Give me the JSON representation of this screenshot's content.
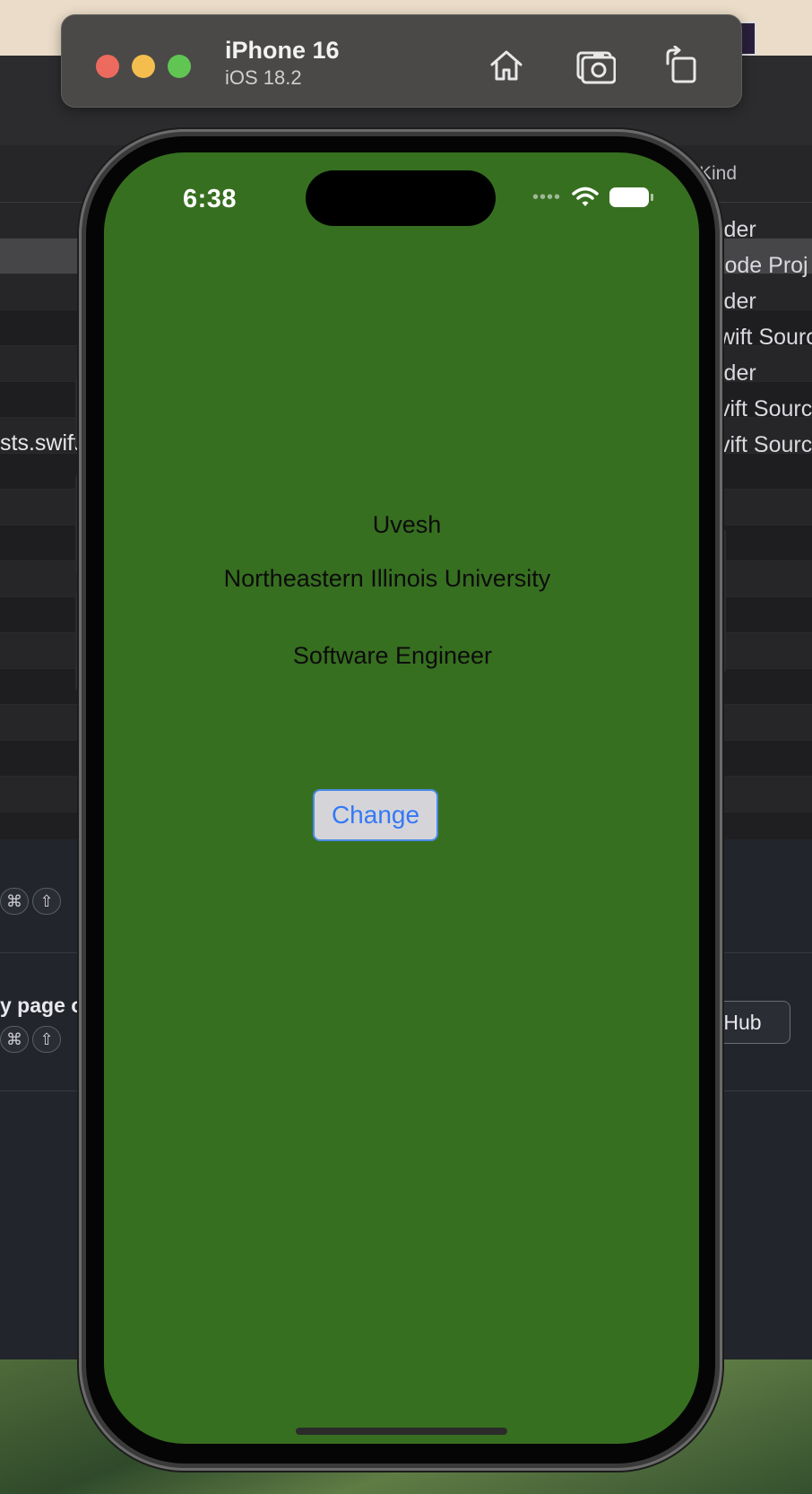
{
  "simulator": {
    "device_name": "iPhone 16",
    "os_version": "iOS 18.2",
    "toolbar_icons": [
      "home-icon",
      "screenshot-icon",
      "rotate-icon"
    ]
  },
  "status_bar": {
    "time": "6:38",
    "signal": "••••"
  },
  "app": {
    "name": "Uvesh",
    "university": "Northeastern Illinois University",
    "role": "Software Engineer",
    "button_label": "Change",
    "background_color": "#376f20",
    "button_text_color": "#3478f6"
  },
  "background_window": {
    "column_header": "Kind",
    "left_text": "sts.swift",
    "kinds": [
      "Folder",
      "Xcode Proj",
      "Folder",
      "Swift Source",
      "Folder",
      "Swift Source",
      "Swift Source"
    ],
    "kind_partials": [
      "lder",
      "code Proj",
      "lder",
      "wift Source",
      "lder",
      "vift Source",
      "vift Source"
    ],
    "page_text": "y page o",
    "github_button": "GitHub",
    "github_partial": "tHub",
    "kbd_cmd": "⌘",
    "kbd_shift": "⇧"
  }
}
